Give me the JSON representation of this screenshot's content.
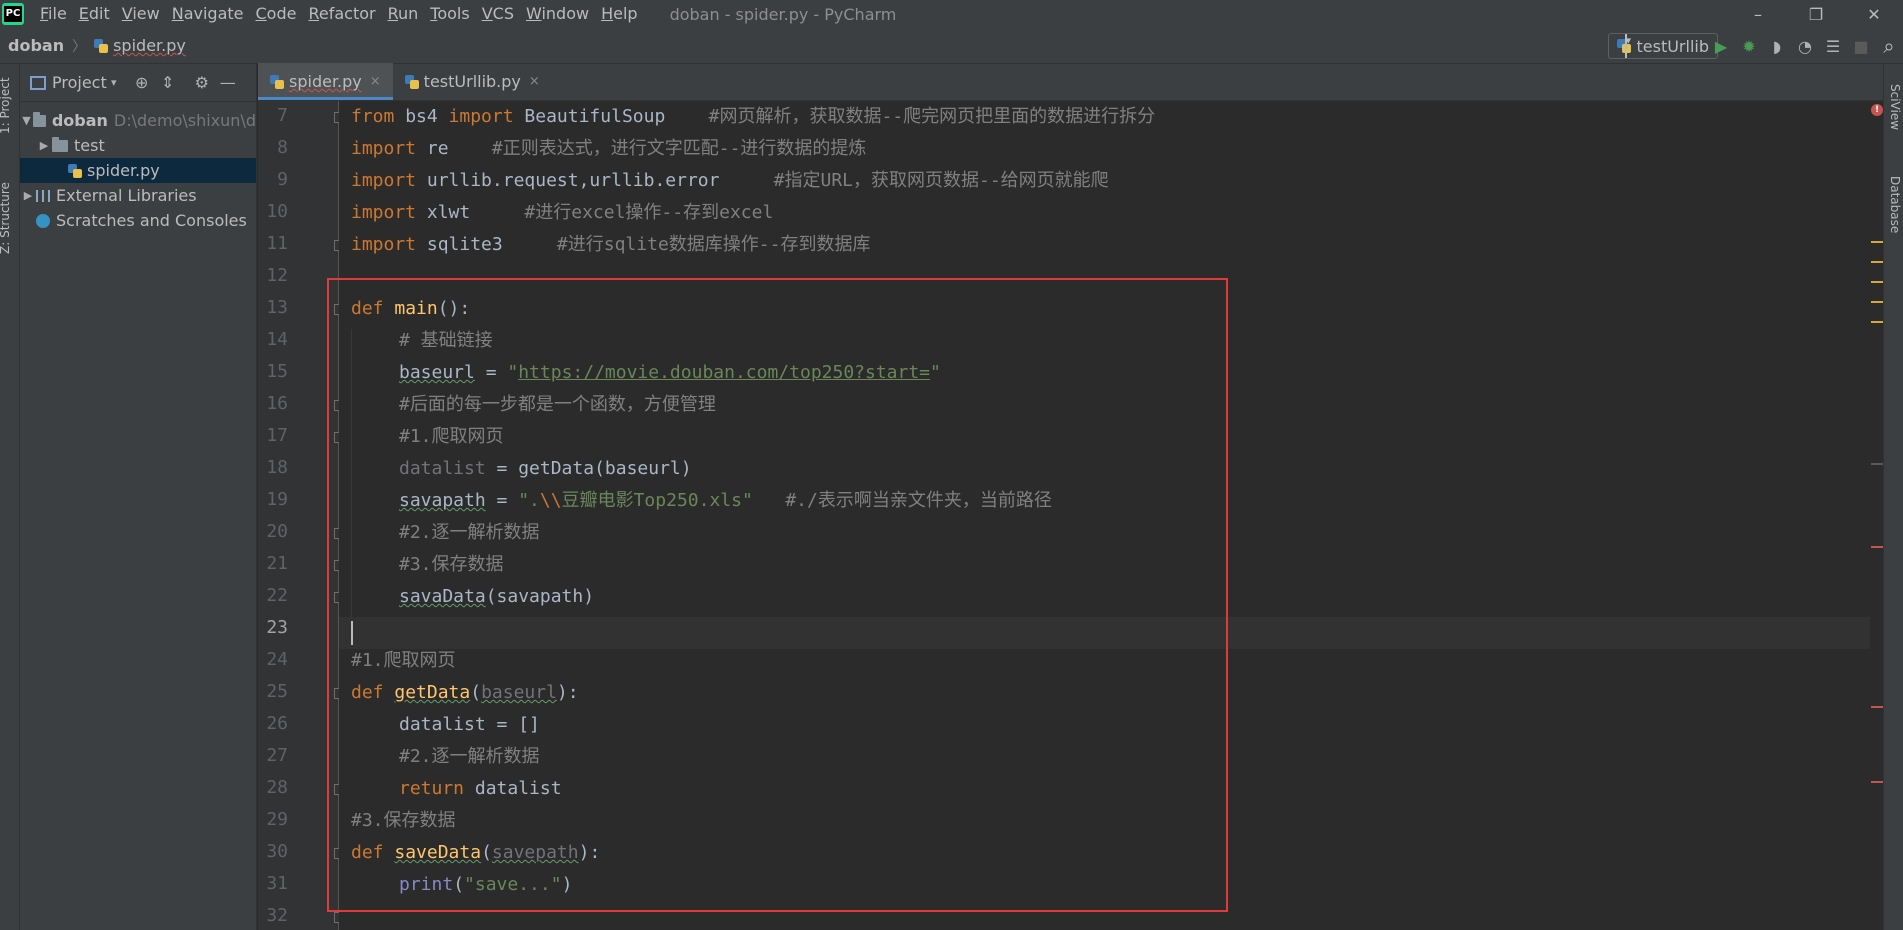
{
  "window": {
    "title": "doban - spider.py - PyCharm",
    "minimize": "–",
    "maximize": "❐",
    "close": "✕"
  },
  "menu": [
    "File",
    "Edit",
    "View",
    "Navigate",
    "Code",
    "Refactor",
    "Run",
    "Tools",
    "VCS",
    "Window",
    "Help"
  ],
  "breadcrumb": {
    "project": "doban",
    "separator": "〉",
    "file": "spider.py"
  },
  "run_config": {
    "name": "testUrllib",
    "caret": "▾"
  },
  "toolbar": {
    "run_icon": "▶",
    "debug_icon": "✹",
    "coverage_icon": "◗",
    "profile_icon": "◔",
    "concurrency_icon": "☰",
    "stop_icon": "■",
    "search_icon": "⌕",
    "run_color": "#499c54",
    "stop_color": "#5a5a5a"
  },
  "left_stripe": {
    "project_label": "1: Project",
    "structure_label": "Z: Structure"
  },
  "project_panel": {
    "title": "Project",
    "dropdown": "▾",
    "locate_icon": "⊕",
    "collapse_icon": "⇕",
    "settings_icon": "⚙",
    "hide_icon": "—",
    "tree": [
      {
        "label": "doban",
        "path": "D:\\demo\\shixun\\d",
        "arrow": "▼"
      },
      {
        "label": "test",
        "arrow": "▶"
      },
      {
        "label": "spider.py"
      },
      {
        "label": "External Libraries",
        "arrow": "▶"
      },
      {
        "label": "Scratches and Consoles"
      }
    ]
  },
  "tabs": [
    {
      "label": "spider.py",
      "close": "×"
    },
    {
      "label": "testUrllib.py",
      "close": "×"
    }
  ],
  "right_stripe": {
    "sciview_label": "SciView",
    "database_label": "Database"
  },
  "error_indicator": "!",
  "line_numbers": [
    "7",
    "8",
    "9",
    "10",
    "11",
    "12",
    "13",
    "14",
    "15",
    "16",
    "17",
    "18",
    "19",
    "20",
    "21",
    "22",
    "23",
    "24",
    "25",
    "26",
    "27",
    "28",
    "29",
    "30",
    "31",
    "32"
  ],
  "code": {
    "l7": {
      "a": "from",
      "b": " bs4 ",
      "c": "import",
      "d": " BeautifulSoup    ",
      "e": "#网页解析，获取数据--爬完网页把里面的数据进行拆分"
    },
    "l8": {
      "a": "import",
      "b": " re    ",
      "c": "#正则表达式，进行文字匹配--进行数据的提炼"
    },
    "l9": {
      "a": "import",
      "b": " urllib.request,urllib.error     ",
      "c": "#指定URL，获取网页数据--给网页就能爬"
    },
    "l10": {
      "a": "import",
      "b": " xlwt     ",
      "c": "#进行excel操作--存到excel"
    },
    "l11": {
      "a": "import",
      "b": " sqlite3     ",
      "c": "#进行sqlite数据库操作--存到数据库"
    },
    "l13": {
      "a": "def",
      "b": "main",
      "c": "():"
    },
    "l14": {
      "a": "# 基础链接"
    },
    "l15": {
      "a": "baseurl",
      "b": " = ",
      "c": "\"",
      "d": "https://movie.douban.com/top250?start=",
      "e": "\""
    },
    "l16": {
      "a": "#后面的每一步都是一个函数，方便管理"
    },
    "l17": {
      "a": "#1.爬取网页"
    },
    "l18": {
      "a": "datalist",
      "b": " = getData(baseurl)"
    },
    "l19": {
      "a": "savapath",
      "b": " = ",
      "c": "\".",
      "d": "\\\\",
      "e": "豆瓣电影Top250.xls\"",
      "f": "   #./表示啊当亲文件夹，当前路径"
    },
    "l20": {
      "a": "#2.逐一解析数据"
    },
    "l21": {
      "a": "#3.保存数据"
    },
    "l22": {
      "a": "savaData",
      "b": "(savapath)"
    },
    "l24": {
      "a": "#1.爬取网页"
    },
    "l25": {
      "a": "def",
      "b": "getData",
      "c": "(",
      "d": "baseurl",
      "e": "):"
    },
    "l26": {
      "a": "datalist = []"
    },
    "l27": {
      "a": "#2.逐一解析数据"
    },
    "l28": {
      "a": "return",
      "b": " datalist"
    },
    "l29": {
      "a": "#3.保存数据"
    },
    "l30": {
      "a": "def",
      "b": "saveData",
      "c": "(",
      "d": "savepath",
      "e": "):"
    },
    "l31": {
      "a": "print",
      "b": "(",
      "c": "\"save...\"",
      "d": ")"
    }
  },
  "colors": {
    "annotation_box": "#e03a3a",
    "keyword": "#cc7832",
    "function": "#ffc66d",
    "string": "#6a8759",
    "comment": "#808080"
  }
}
